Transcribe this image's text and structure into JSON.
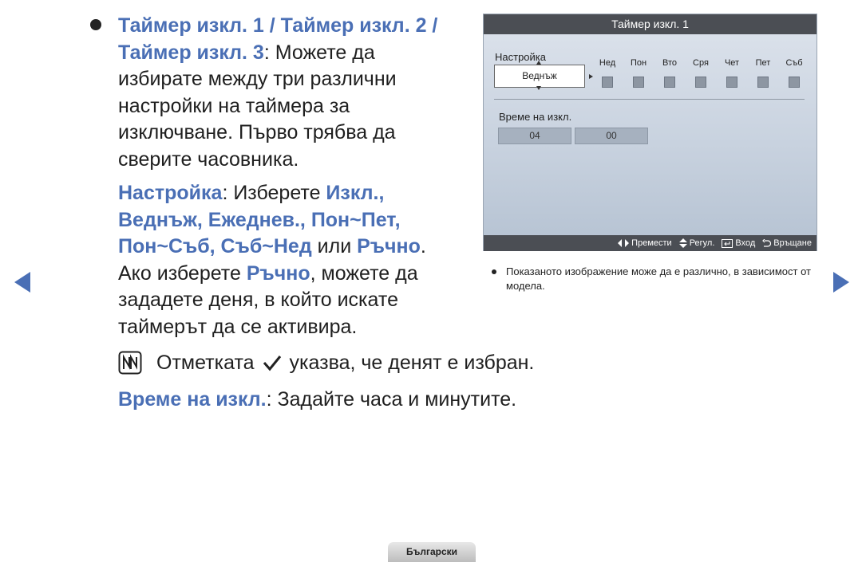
{
  "bullet": {
    "timers_title": "Таймер изкл. 1 / Таймер изкл. 2 / Таймер изкл. 3",
    "timers_desc": ": Можете да избирате между три различни настройки на таймера за изключване. Първо трябва да сверите часовника."
  },
  "setup_para": {
    "term": "Настройка",
    "intro": ": Изберете ",
    "options": "Изкл., Веднъж, Ежеднев., Пон~Пет, Пон~Съб, Съб~Нед",
    "or_word": " или ",
    "manual": "Ръчно",
    "after_manual": ".",
    "line2_start": " Ако изберете ",
    "manual2": "Ръчно",
    "line2_end": ", можете да зададете деня, в който искате таймерът да се активира."
  },
  "note": {
    "before_check": "Отметката",
    "after_check": "указва, че денят е избран."
  },
  "off_time_para": {
    "term": "Време на изкл.",
    "desc": ": Задайте часа и минутите."
  },
  "tv_screen": {
    "title": "Таймер изкл. 1",
    "setting_label": "Настройка",
    "dropdown_value": "Веднъж",
    "days": [
      "Нед",
      "Пон",
      "Вто",
      "Сря",
      "Чет",
      "Пет",
      "Съб"
    ],
    "off_time_label": "Време на изкл.",
    "hour": "04",
    "minute": "00",
    "hints": {
      "move": "Премести",
      "adjust": "Регул.",
      "enter": "Вход",
      "return": "Връщане"
    }
  },
  "caption": "Показаното изображение може да е различно, в зависимост от модела.",
  "language_tab": "Български",
  "colors": {
    "accent": "#4a6fb5",
    "tv_bar": "#4b4e54"
  }
}
